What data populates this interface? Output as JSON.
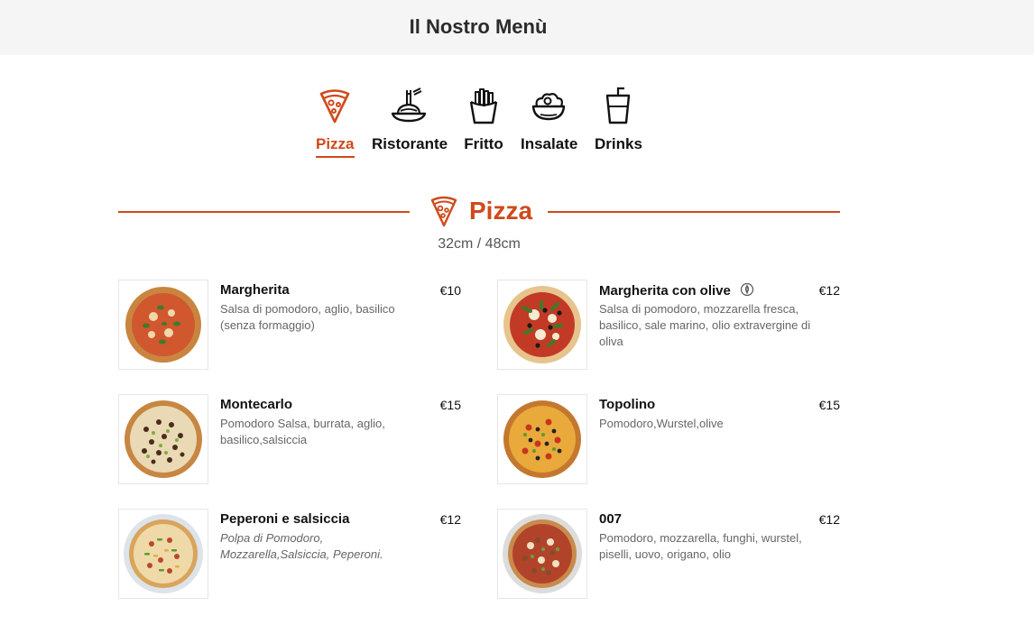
{
  "header": {
    "title": "Il Nostro Menù"
  },
  "categories": [
    {
      "label": "Pizza",
      "icon": "pizza-slice-icon",
      "active": true
    },
    {
      "label": "Ristorante",
      "icon": "spaghetti-icon"
    },
    {
      "label": "Fritto",
      "icon": "fries-icon"
    },
    {
      "label": "Insalate",
      "icon": "salad-bowl-icon"
    },
    {
      "label": "Drinks",
      "icon": "drink-cup-icon"
    }
  ],
  "section": {
    "title": "Pizza",
    "icon": "pizza-slice-icon",
    "sizes": "32cm / 48cm"
  },
  "items": [
    {
      "name": "Margherita",
      "price": "€10",
      "desc": "Salsa di pomodoro, aglio, basilico (senza formaggio)"
    },
    {
      "name": "Margherita con olive",
      "price": "€12",
      "desc": "Salsa di pomodoro, mozzarella fresca, basilico, sale marino, olio extravergine di oliva",
      "badge": "vegetarian-icon"
    },
    {
      "name": "Montecarlo",
      "price": "€15",
      "desc": "Pomodoro Salsa, burrata, aglio, basilico,salsiccia"
    },
    {
      "name": "Topolino",
      "price": "€15",
      "desc": "Pomodoro,Wurstel,olive"
    },
    {
      "name": "Peperoni e salsiccia",
      "price": "€12",
      "desc": "Polpa di Pomodoro, Mozzarella,Salsiccia, Peperoni."
    },
    {
      "name": "007",
      "price": "€12",
      "desc": "Pomodoro, mozzarella, funghi, wurstel, piselli, uovo, origano, olio"
    }
  ],
  "colors": {
    "accent": "#cf4a1b",
    "header_bg": "#f5f5f5"
  }
}
